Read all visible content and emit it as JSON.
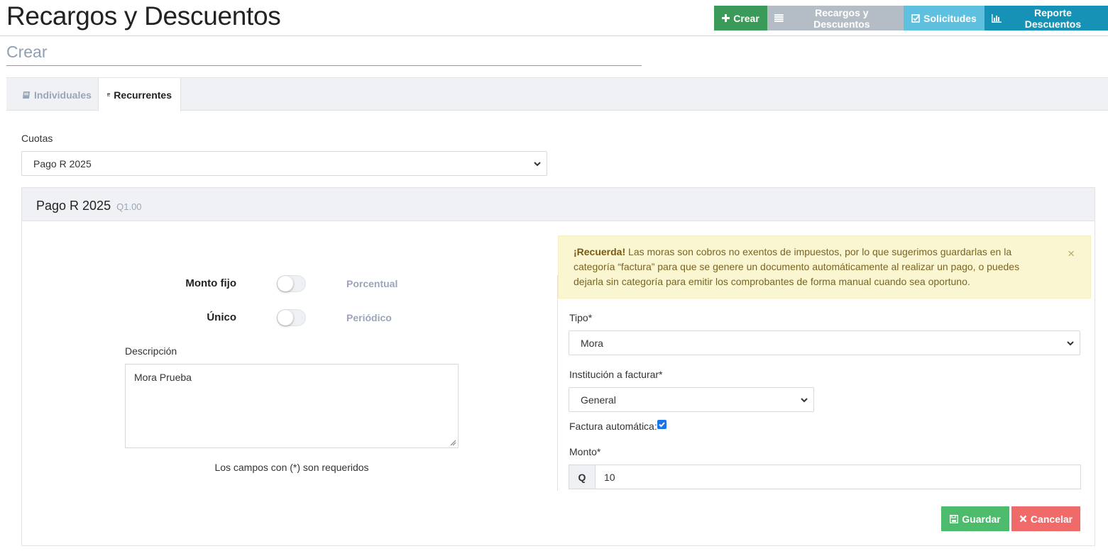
{
  "header": {
    "title": "Recargos y Descuentos",
    "actions": {
      "crear": "Crear",
      "recargos": "Recargos y Descuentos",
      "solicitudes": "Solicitudes",
      "reporte": "Reporte Descuentos"
    }
  },
  "subtitle": "Crear",
  "tabs": [
    {
      "label": "Individuales",
      "icon": "book-icon",
      "active": false
    },
    {
      "label": "Recurrentes",
      "icon": "calendar-icon",
      "active": true
    }
  ],
  "cuotas": {
    "label": "Cuotas",
    "selected": "Pago R 2025"
  },
  "card": {
    "title": "Pago R 2025",
    "price": "Q1.00"
  },
  "toggles": {
    "monto": {
      "left": "Monto fijo",
      "right": "Porcentual",
      "on": false
    },
    "frecuencia": {
      "left": "Único",
      "right": "Periódico",
      "on": false
    }
  },
  "descripcion": {
    "label": "Descripción",
    "value": "Mora Prueba"
  },
  "required_note": "Los campos con (*) son requeridos",
  "alert": {
    "strong": "¡Recuerda!",
    "text": " Las moras son cobros no exentos de impuestos, por lo que sugerimos guardarlas en la categoría “factura” para que se genere un documento automáticamente al realizar un pago, o puedes dejarla sin categoría para emitir los comprobantes de forma manual cuando sea oportuno.",
    "close": "×",
    "color": "#fbf6d2"
  },
  "tipo": {
    "label": "Tipo*",
    "selected": "Mora"
  },
  "institucion": {
    "label": "Institución a facturar*",
    "selected": "General"
  },
  "factura": {
    "label": "Factura automática:",
    "checked": true
  },
  "monto": {
    "label": "Monto*",
    "prefix": "Q",
    "value": "10"
  },
  "buttons": {
    "guardar": "Guardar",
    "cancelar": "Cancelar"
  },
  "colors": {
    "success": "#3a9a5a",
    "info": "#5cc0de",
    "primary": "#1592b6",
    "danger": "#f06a6a"
  }
}
